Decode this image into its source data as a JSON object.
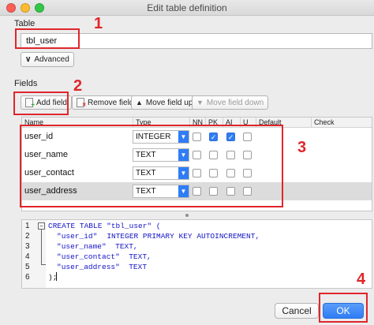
{
  "window": {
    "title": "Edit table definition"
  },
  "table_section": {
    "label": "Table",
    "name_value": "tbl_user",
    "advanced_label": "Advanced"
  },
  "fields_section": {
    "label": "Fields",
    "toolbar": {
      "add_field": "Add field",
      "remove_field": "Remove field",
      "move_up": "Move field up",
      "move_down": "Move field down"
    },
    "columns": [
      "Name",
      "Type",
      "NN",
      "PK",
      "AI",
      "U",
      "Default",
      "Check"
    ],
    "rows": [
      {
        "name": "user_id",
        "type": "INTEGER",
        "nn": false,
        "pk": true,
        "ai": true,
        "u": false
      },
      {
        "name": "user_name",
        "type": "TEXT",
        "nn": false,
        "pk": false,
        "ai": false,
        "u": false
      },
      {
        "name": "user_contact",
        "type": "TEXT",
        "nn": false,
        "pk": false,
        "ai": false,
        "u": false
      },
      {
        "name": "user_address",
        "type": "TEXT",
        "nn": false,
        "pk": false,
        "ai": false,
        "u": false
      }
    ]
  },
  "sql_preview": {
    "line_numbers": [
      "1",
      "2",
      "3",
      "4",
      "5",
      "6"
    ],
    "line1_kw": "CREATE TABLE",
    "line1_rest": " \"tbl_user\" (",
    "line2_col": "\"user_id\"",
    "line2_def": "INTEGER PRIMARY KEY AUTOINCREMENT,",
    "line3": "\"user_name\"  TEXT,",
    "line4": "\"user_contact\"  TEXT,",
    "line5": "\"user_address\"  TEXT",
    "line6": ");"
  },
  "footer": {
    "cancel_label": "Cancel",
    "ok_label": "OK"
  },
  "annotations": {
    "n1": "1",
    "n2": "2",
    "n3": "3",
    "n4": "4"
  },
  "colors": {
    "accent": "#2f7df6",
    "annotation_red": "#e0262b"
  }
}
